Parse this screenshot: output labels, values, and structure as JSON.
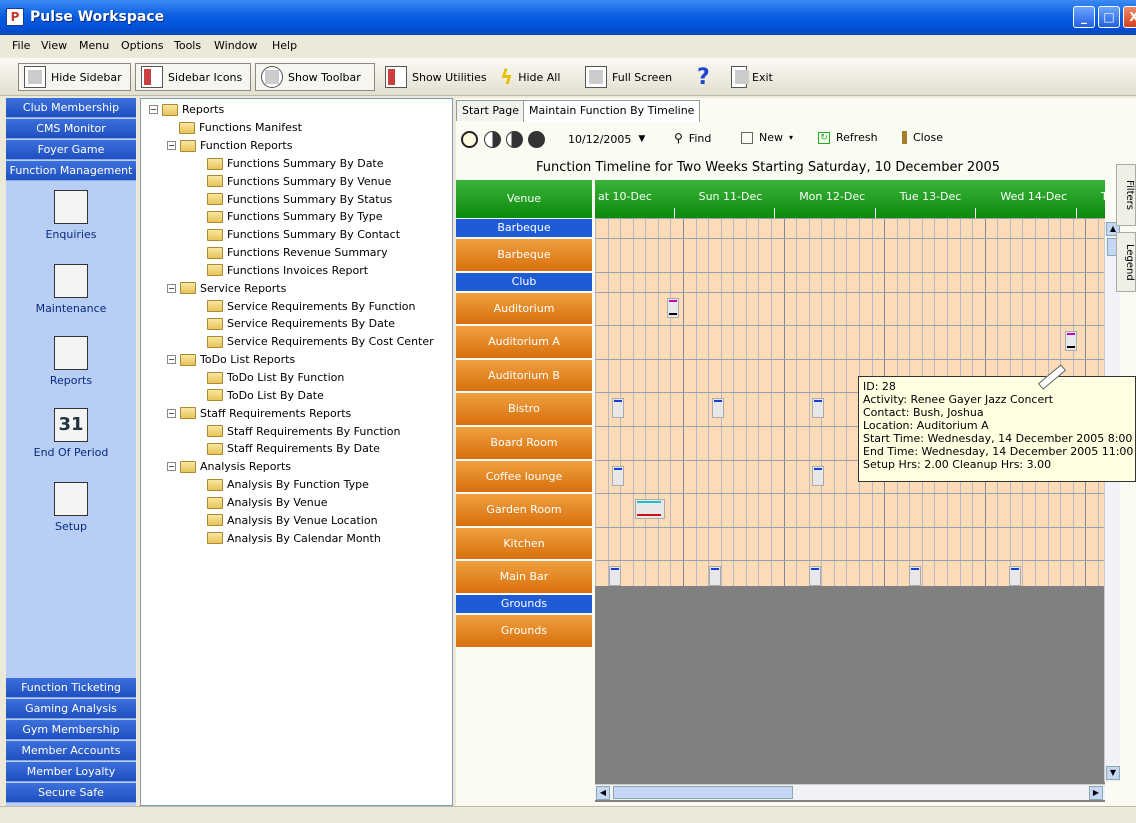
{
  "window": {
    "title": "Pulse Workspace",
    "min": "_",
    "max": "□",
    "close": "X"
  },
  "menu": [
    "File",
    "View",
    "Menu",
    "Options",
    "Tools",
    "Window",
    "Help"
  ],
  "toolbar": {
    "hide_sidebar": "Hide Sidebar",
    "sidebar_icons": "Sidebar Icons",
    "show_toolbar": "Show Toolbar",
    "show_utilities": "Show Utilities",
    "hide_all": "Hide All",
    "full_screen": "Full Screen",
    "exit": "Exit"
  },
  "sidebar": {
    "top": [
      "Club Membership",
      "CMS Monitor",
      "Foyer Game",
      "Function Management"
    ],
    "tools": [
      "Enquiries",
      "Maintenance",
      "Reports",
      "End Of Period",
      "Setup"
    ],
    "calendar_day": "31",
    "bottom": [
      "Function Ticketing",
      "Gaming Analysis",
      "Gym Membership",
      "Member Accounts",
      "Member Loyalty",
      "Secure Safe"
    ]
  },
  "tree": {
    "root": "Reports",
    "items": [
      {
        "label": "Functions Manifest"
      },
      {
        "label": "Function Reports",
        "children": [
          "Functions Summary By Date",
          "Functions Summary By Venue",
          "Functions Summary By Status",
          "Functions Summary By Type",
          "Functions Summary By Contact",
          "Functions Revenue Summary",
          "Functions Invoices Report"
        ]
      },
      {
        "label": "Service Reports",
        "children": [
          "Service Requirements By Function",
          "Service Requirements By Date",
          "Service Requirements By Cost Center"
        ]
      },
      {
        "label": "ToDo List Reports",
        "children": [
          "ToDo List By Function",
          "ToDo List By Date"
        ]
      },
      {
        "label": "Staff Requirements Reports",
        "children": [
          "Staff Requirements By Function",
          "Staff Requirements By Date"
        ]
      },
      {
        "label": "Analysis Reports",
        "children": [
          "Analysis By Function Type",
          "Analysis By Venue",
          "Analysis By Venue Location",
          "Analysis By Calendar Month"
        ]
      }
    ]
  },
  "tabs": [
    "Start Page",
    "Maintain Function By Timeline"
  ],
  "subbar": {
    "date": "10/12/2005",
    "find": "Find",
    "new": "New",
    "refresh": "Refresh",
    "close": "Close"
  },
  "timeline": {
    "title": "Function Timeline for  Two Weeks Starting Saturday, 10 December 2005",
    "venue_header": "Venue",
    "days": [
      "at 10-Dec",
      "Sun 11-Dec",
      "Mon 12-Dec",
      "Tue 13-Dec",
      "Wed 14-Dec",
      "Thu"
    ],
    "venues": [
      {
        "label": "Barbeque",
        "kind": "group"
      },
      {
        "label": "Barbeque",
        "kind": "venue"
      },
      {
        "label": "Club",
        "kind": "group"
      },
      {
        "label": "Auditorium",
        "kind": "venue"
      },
      {
        "label": "Auditorium A",
        "kind": "venue"
      },
      {
        "label": "Auditorium B",
        "kind": "venue"
      },
      {
        "label": "Bistro",
        "kind": "venue"
      },
      {
        "label": "Board Room",
        "kind": "venue"
      },
      {
        "label": "Coffee lounge",
        "kind": "venue"
      },
      {
        "label": "Garden Room",
        "kind": "venue"
      },
      {
        "label": "Kitchen",
        "kind": "venue"
      },
      {
        "label": "Main Bar",
        "kind": "venue"
      },
      {
        "label": "Grounds",
        "kind": "group"
      },
      {
        "label": "Grounds",
        "kind": "venue"
      }
    ]
  },
  "tooltip": {
    "lines": [
      "ID: 28",
      "Activity: Renee Gayer Jazz Concert",
      "Contact: Bush, Joshua",
      "Location: Auditorium A",
      "Start Time: Wednesday, 14 December 2005 8:00 PM",
      "End Time: Wednesday, 14 December 2005 11:00 PM",
      "Setup Hrs: 2.00  Cleanup Hrs: 3.00"
    ]
  },
  "side_tabs": [
    "Filters",
    "Legend"
  ],
  "colors": {
    "titlebar": "#0a5ee0",
    "nav_button": "#1f4fc0",
    "venue_orange": "#e07d18",
    "group_blue": "#1e5bd6",
    "header_green": "#0c8a0c",
    "weekend_band": "#fbdcb6"
  }
}
